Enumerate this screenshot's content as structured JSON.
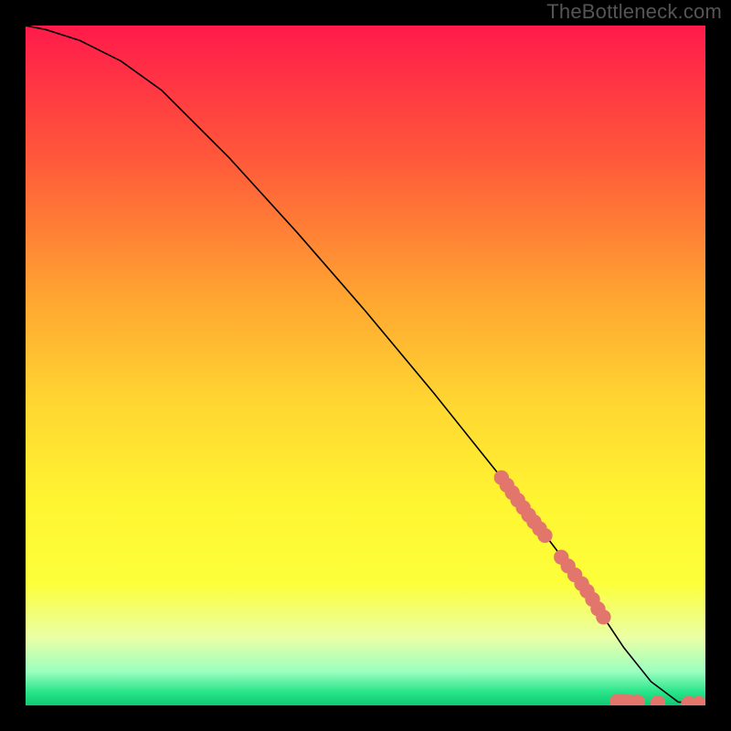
{
  "watermark": "TheBottleneck.com",
  "chart_data": {
    "type": "line",
    "title": "",
    "xlabel": "",
    "ylabel": "",
    "xlim": [
      0,
      100
    ],
    "ylim": [
      0,
      100
    ],
    "gradient_stops": [
      {
        "offset": 0,
        "color": "#ff1a4b"
      },
      {
        "offset": 20,
        "color": "#ff5a3a"
      },
      {
        "offset": 40,
        "color": "#ffa531"
      },
      {
        "offset": 55,
        "color": "#ffd531"
      },
      {
        "offset": 70,
        "color": "#fff531"
      },
      {
        "offset": 82,
        "color": "#fcff3a"
      },
      {
        "offset": 90,
        "color": "#eaffa6"
      },
      {
        "offset": 95,
        "color": "#9cffc0"
      },
      {
        "offset": 98,
        "color": "#29e58a"
      },
      {
        "offset": 100,
        "color": "#10c873"
      }
    ],
    "series": [
      {
        "name": "main-curve",
        "type": "line",
        "x": [
          0,
          3,
          8,
          14,
          20,
          30,
          40,
          50,
          60,
          70,
          78,
          84,
          88,
          92,
          96,
          100
        ],
        "y": [
          100,
          99.4,
          97.8,
          94.8,
          90.5,
          80.5,
          69.5,
          58,
          46,
          33.5,
          23,
          14.5,
          8.5,
          3.5,
          0.5,
          0.3
        ]
      }
    ],
    "markers": {
      "name": "highlight-points",
      "color": "#e3766c",
      "radius_frac": 0.011,
      "points": [
        {
          "x": 70.0,
          "y": 33.5
        },
        {
          "x": 70.8,
          "y": 32.4
        },
        {
          "x": 71.6,
          "y": 31.3
        },
        {
          "x": 72.4,
          "y": 30.2
        },
        {
          "x": 73.2,
          "y": 29.1
        },
        {
          "x": 74.0,
          "y": 28.0
        },
        {
          "x": 74.8,
          "y": 27.0
        },
        {
          "x": 75.6,
          "y": 26.0
        },
        {
          "x": 76.4,
          "y": 25.0
        },
        {
          "x": 78.8,
          "y": 21.8
        },
        {
          "x": 79.8,
          "y": 20.5
        },
        {
          "x": 80.8,
          "y": 19.2
        },
        {
          "x": 81.8,
          "y": 17.9
        },
        {
          "x": 82.6,
          "y": 16.8
        },
        {
          "x": 83.4,
          "y": 15.6
        },
        {
          "x": 84.2,
          "y": 14.2
        },
        {
          "x": 85.0,
          "y": 13.0
        },
        {
          "x": 87.0,
          "y": 0.6
        },
        {
          "x": 88.0,
          "y": 0.6
        },
        {
          "x": 89.0,
          "y": 0.5
        },
        {
          "x": 90.0,
          "y": 0.5
        },
        {
          "x": 93.0,
          "y": 0.4
        },
        {
          "x": 97.5,
          "y": 0.3
        },
        {
          "x": 99.0,
          "y": 0.3
        }
      ]
    }
  }
}
